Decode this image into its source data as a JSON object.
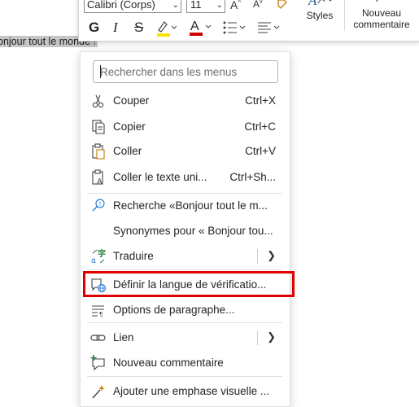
{
  "document": {
    "selected_text": "onjour tout le monde !"
  },
  "mini_toolbar": {
    "font_name": "Calibri (Corps)",
    "font_size": "11",
    "bold": "G",
    "italic": "I",
    "strike": "S",
    "highlight_color": "#f7e400",
    "font_color": "#d10000",
    "styles_label": "Styles",
    "comment_label_line1": "Nouveau",
    "comment_label_line2": "commentaire"
  },
  "context_menu": {
    "search_placeholder": "Rechercher dans les menus",
    "items": [
      {
        "label": "Couper",
        "shortcut": "Ctrl+X",
        "icon": "scissors-icon"
      },
      {
        "label": "Copier",
        "shortcut": "Ctrl+C",
        "icon": "copy-icon"
      },
      {
        "label": "Coller",
        "shortcut": "Ctrl+V",
        "icon": "paste-icon"
      },
      {
        "label": "Coller le texte uni...",
        "shortcut": "Ctrl+Sh...",
        "icon": "paste-text-icon"
      },
      {
        "label": "Recherche «Bonjour tout le m...",
        "icon": "search-lookup-icon"
      },
      {
        "label": "Synonymes pour « Bonjour tou...",
        "icon": ""
      },
      {
        "label": "Traduire",
        "icon": "translate-icon",
        "submenu": true
      },
      {
        "label": "Définir la langue de vérificatio...",
        "icon": "language-icon",
        "highlighted": true
      },
      {
        "label": "Options de paragraphe...",
        "icon": "paragraph-icon"
      },
      {
        "label": "Lien",
        "icon": "link-icon",
        "submenu": true
      },
      {
        "label": "Nouveau commentaire",
        "icon": "comment-icon"
      },
      {
        "label": "Ajouter une emphase visuelle ...",
        "icon": "sparkle-wand-icon"
      }
    ],
    "highlight_color": "#e00000"
  }
}
